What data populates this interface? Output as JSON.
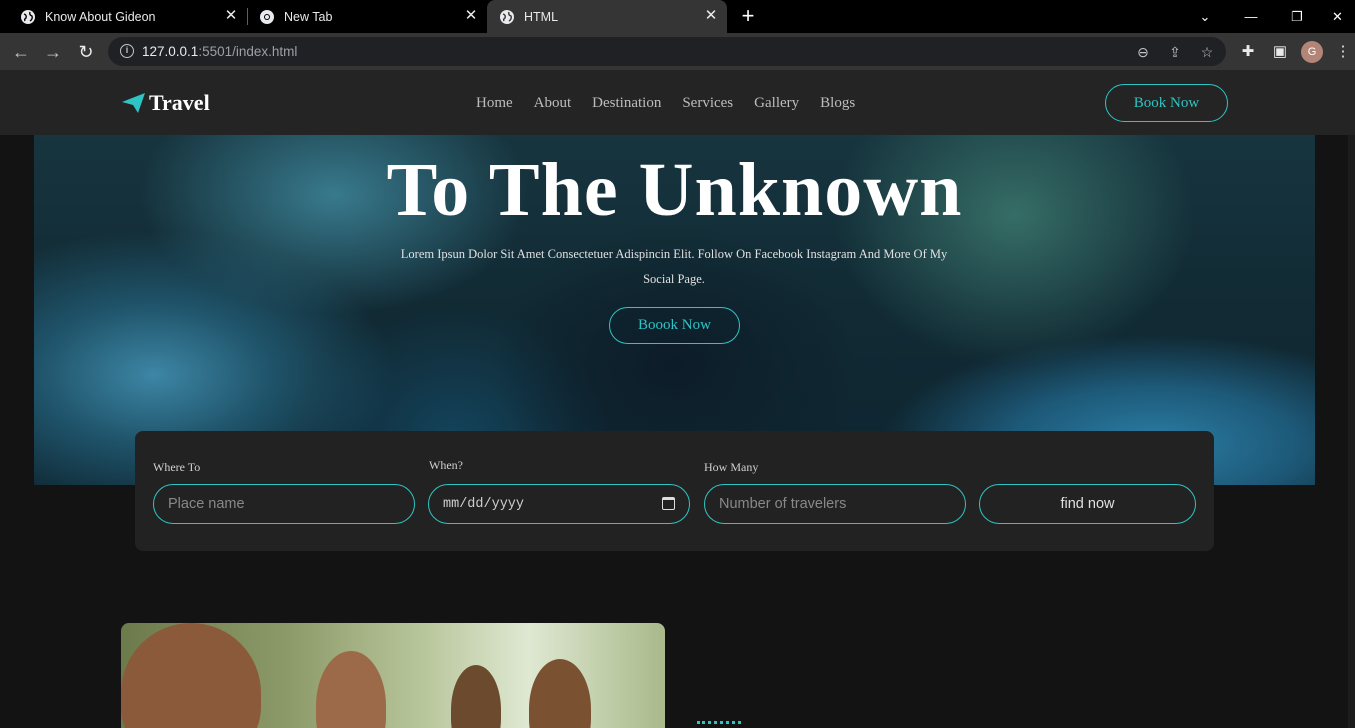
{
  "browser": {
    "tabs": [
      {
        "title": "Know About Gideon",
        "active": false
      },
      {
        "title": "New Tab",
        "active": false
      },
      {
        "title": "HTML",
        "active": true
      }
    ],
    "url_host": "127.0.0.1",
    "url_rest": ":5501/index.html",
    "profile_initial": "G"
  },
  "site": {
    "logo_text": "Travel",
    "nav": [
      "Home",
      "About",
      "Destination",
      "Services",
      "Gallery",
      "Blogs"
    ],
    "header_button": "Book Now",
    "accent_color": "#2ec4c4"
  },
  "hero": {
    "title": "To The Unknown",
    "subtitle": "Lorem Ipsun Dolor Sit Amet Consectetuer Adispincin Elit. Follow On Facebook Instagram And More Of My Social Page.",
    "button": "Boook Now"
  },
  "search": {
    "where_label": "Where To",
    "where_placeholder": "Place name",
    "when_label": "When?",
    "when_value": "mm/dd/yyyy",
    "how_many_label": "How Many",
    "how_many_placeholder": "Number of travelers",
    "find_button": "find now"
  }
}
